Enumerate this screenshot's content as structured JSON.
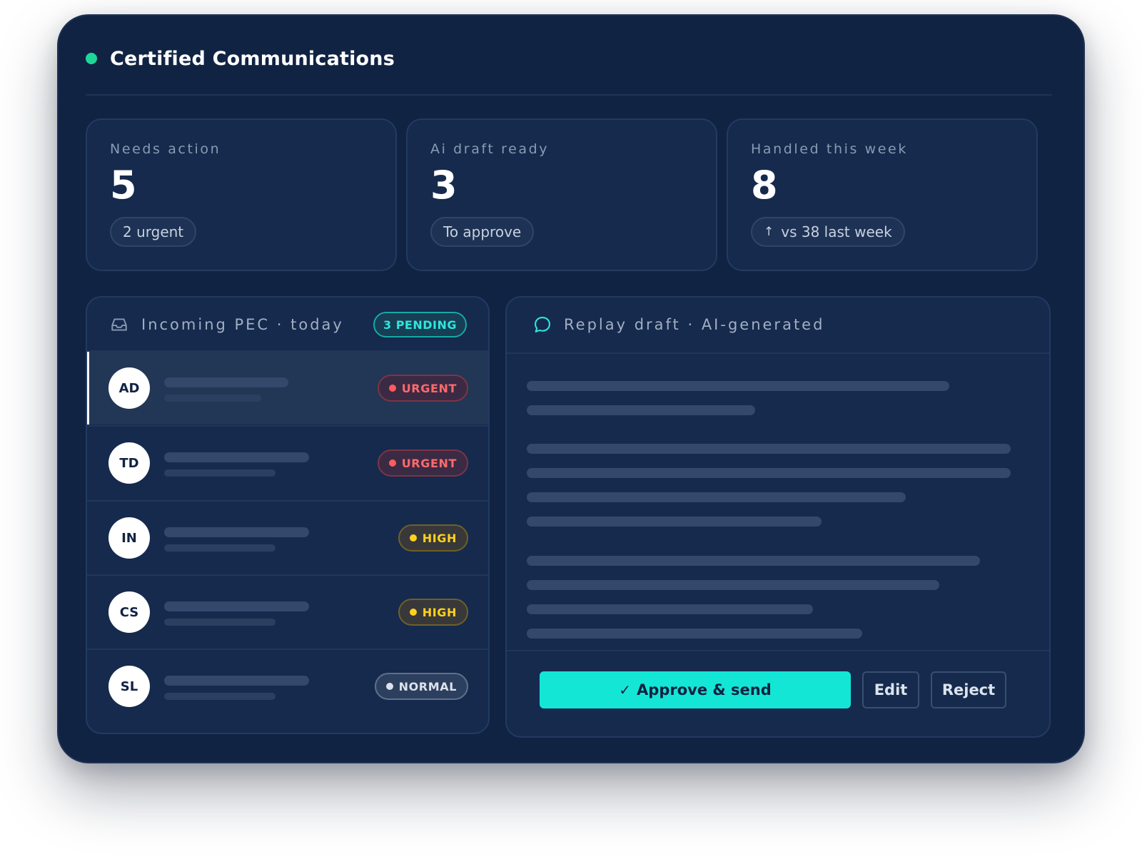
{
  "header": {
    "title": "Certified Communications",
    "status_color": "#1fd69a"
  },
  "stats": [
    {
      "label": "Needs action",
      "value": "5",
      "chip": "2 urgent"
    },
    {
      "label": "Ai draft ready",
      "value": "3",
      "chip": "To approve"
    },
    {
      "label": "Handled this week",
      "value": "8",
      "chip": "vs 38 last week",
      "chip_icon": "arrow-up-icon"
    }
  ],
  "inbox": {
    "title": "Incoming PEC · today",
    "icon": "inbox-icon",
    "pending_badge": "3 PENDING",
    "messages": [
      {
        "initials": "AD",
        "priority": "URGENT",
        "level": "urgent",
        "selected": true
      },
      {
        "initials": "TD",
        "priority": "URGENT",
        "level": "urgent",
        "selected": false
      },
      {
        "initials": "IN",
        "priority": "HIGH",
        "level": "high",
        "selected": false
      },
      {
        "initials": "CS",
        "priority": "HIGH",
        "level": "high",
        "selected": false
      },
      {
        "initials": "SL",
        "priority": "NORMAL",
        "level": "normal",
        "selected": false
      }
    ]
  },
  "draft": {
    "title": "Replay draft · AI-generated",
    "icon": "chat-bubble-icon",
    "actions": {
      "approve": "Approve & send",
      "edit": "Edit",
      "reject": "Reject"
    }
  },
  "colors": {
    "background": "#112343",
    "accent": "#14e6d6",
    "urgent": "#ff5c5c",
    "high": "#ffd21e"
  }
}
